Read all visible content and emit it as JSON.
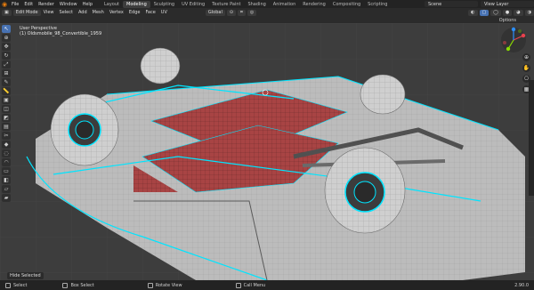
{
  "topbar": {
    "menu": [
      "File",
      "Edit",
      "Render",
      "Window",
      "Help"
    ],
    "workspaces": [
      "Layout",
      "Modeling",
      "Sculpting",
      "UV Editing",
      "Texture Paint",
      "Shading",
      "Animation",
      "Rendering",
      "Compositing",
      "Scripting"
    ],
    "active_workspace": "Modeling",
    "scene": "Scene",
    "view_layer": "View Layer"
  },
  "header": {
    "mode": "Edit Mode",
    "menus": [
      "View",
      "Select",
      "Add",
      "Mesh",
      "Vertex",
      "Edge",
      "Face",
      "UV"
    ],
    "orientation": "Global",
    "options": "Options"
  },
  "viewport": {
    "title": "User Perspective",
    "object": "(1) Oldsmobile_98_Convertible_1959",
    "hide_selected": "Hide Selected"
  },
  "status": {
    "items": [
      "Select",
      "Box Select",
      "Rotate View",
      "Call Menu"
    ],
    "version": "2.90.0"
  },
  "colors": {
    "accent": "#4772b3",
    "selected_edges": "#00e5ff",
    "seat": "#b04545",
    "mesh": "#c8c8c8"
  }
}
